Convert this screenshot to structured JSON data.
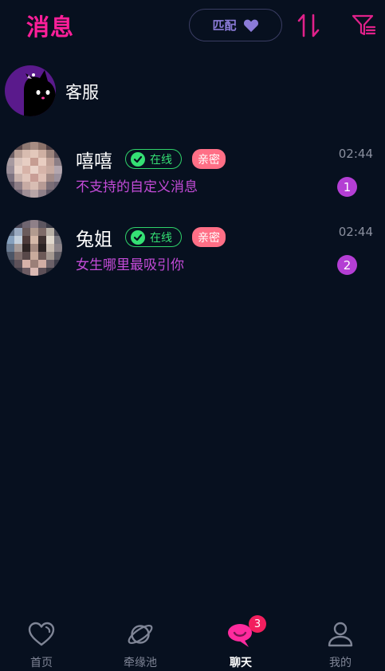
{
  "header": {
    "title": "消息",
    "match_label": "匹配",
    "icons": {
      "match": "heart-icon",
      "sort": "sort-icon",
      "filter": "filter-icon"
    }
  },
  "service": {
    "name": "客服",
    "avatar": "cat-avatar"
  },
  "chats": [
    {
      "name": "嘻嘻",
      "online_label": "在线",
      "tag": "亲密",
      "message": "不支持的自定义消息",
      "time": "02:44",
      "unread": "1"
    },
    {
      "name": "兔姐",
      "online_label": "在线",
      "tag": "亲密",
      "message": "女生哪里最吸引你",
      "time": "02:44",
      "unread": "2"
    }
  ],
  "tabs": [
    {
      "label": "首页",
      "icon": "heart-icon"
    },
    {
      "label": "牵缘池",
      "icon": "planet-icon"
    },
    {
      "label": "聊天",
      "icon": "chat-icon",
      "badge": "3"
    },
    {
      "label": "我的",
      "icon": "user-icon"
    }
  ],
  "colors": {
    "background": "#07101f",
    "accent": "#ff1f9a",
    "message": "#c44bd8",
    "online": "#35e074",
    "intimate": "#ff6f86",
    "badge": "#f21f5e"
  }
}
